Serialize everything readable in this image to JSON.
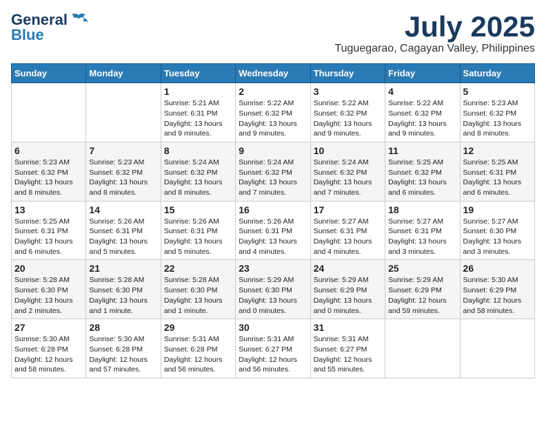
{
  "logo": {
    "line1": "General",
    "line2": "Blue"
  },
  "title": "July 2025",
  "location": "Tuguegarao, Cagayan Valley, Philippines",
  "days_of_week": [
    "Sunday",
    "Monday",
    "Tuesday",
    "Wednesday",
    "Thursday",
    "Friday",
    "Saturday"
  ],
  "weeks": [
    [
      {
        "day": "",
        "info": ""
      },
      {
        "day": "",
        "info": ""
      },
      {
        "day": "1",
        "info": "Sunrise: 5:21 AM\nSunset: 6:31 PM\nDaylight: 13 hours\nand 9 minutes."
      },
      {
        "day": "2",
        "info": "Sunrise: 5:22 AM\nSunset: 6:32 PM\nDaylight: 13 hours\nand 9 minutes."
      },
      {
        "day": "3",
        "info": "Sunrise: 5:22 AM\nSunset: 6:32 PM\nDaylight: 13 hours\nand 9 minutes."
      },
      {
        "day": "4",
        "info": "Sunrise: 5:22 AM\nSunset: 6:32 PM\nDaylight: 13 hours\nand 9 minutes."
      },
      {
        "day": "5",
        "info": "Sunrise: 5:23 AM\nSunset: 6:32 PM\nDaylight: 13 hours\nand 8 minutes."
      }
    ],
    [
      {
        "day": "6",
        "info": "Sunrise: 5:23 AM\nSunset: 6:32 PM\nDaylight: 13 hours\nand 8 minutes."
      },
      {
        "day": "7",
        "info": "Sunrise: 5:23 AM\nSunset: 6:32 PM\nDaylight: 13 hours\nand 8 minutes."
      },
      {
        "day": "8",
        "info": "Sunrise: 5:24 AM\nSunset: 6:32 PM\nDaylight: 13 hours\nand 8 minutes."
      },
      {
        "day": "9",
        "info": "Sunrise: 5:24 AM\nSunset: 6:32 PM\nDaylight: 13 hours\nand 7 minutes."
      },
      {
        "day": "10",
        "info": "Sunrise: 5:24 AM\nSunset: 6:32 PM\nDaylight: 13 hours\nand 7 minutes."
      },
      {
        "day": "11",
        "info": "Sunrise: 5:25 AM\nSunset: 6:32 PM\nDaylight: 13 hours\nand 6 minutes."
      },
      {
        "day": "12",
        "info": "Sunrise: 5:25 AM\nSunset: 6:31 PM\nDaylight: 13 hours\nand 6 minutes."
      }
    ],
    [
      {
        "day": "13",
        "info": "Sunrise: 5:25 AM\nSunset: 6:31 PM\nDaylight: 13 hours\nand 6 minutes."
      },
      {
        "day": "14",
        "info": "Sunrise: 5:26 AM\nSunset: 6:31 PM\nDaylight: 13 hours\nand 5 minutes."
      },
      {
        "day": "15",
        "info": "Sunrise: 5:26 AM\nSunset: 6:31 PM\nDaylight: 13 hours\nand 5 minutes."
      },
      {
        "day": "16",
        "info": "Sunrise: 5:26 AM\nSunset: 6:31 PM\nDaylight: 13 hours\nand 4 minutes."
      },
      {
        "day": "17",
        "info": "Sunrise: 5:27 AM\nSunset: 6:31 PM\nDaylight: 13 hours\nand 4 minutes."
      },
      {
        "day": "18",
        "info": "Sunrise: 5:27 AM\nSunset: 6:31 PM\nDaylight: 13 hours\nand 3 minutes."
      },
      {
        "day": "19",
        "info": "Sunrise: 5:27 AM\nSunset: 6:30 PM\nDaylight: 13 hours\nand 3 minutes."
      }
    ],
    [
      {
        "day": "20",
        "info": "Sunrise: 5:28 AM\nSunset: 6:30 PM\nDaylight: 13 hours\nand 2 minutes."
      },
      {
        "day": "21",
        "info": "Sunrise: 5:28 AM\nSunset: 6:30 PM\nDaylight: 13 hours\nand 1 minute."
      },
      {
        "day": "22",
        "info": "Sunrise: 5:28 AM\nSunset: 6:30 PM\nDaylight: 13 hours\nand 1 minute."
      },
      {
        "day": "23",
        "info": "Sunrise: 5:29 AM\nSunset: 6:30 PM\nDaylight: 13 hours\nand 0 minutes."
      },
      {
        "day": "24",
        "info": "Sunrise: 5:29 AM\nSunset: 6:29 PM\nDaylight: 13 hours\nand 0 minutes."
      },
      {
        "day": "25",
        "info": "Sunrise: 5:29 AM\nSunset: 6:29 PM\nDaylight: 12 hours\nand 59 minutes."
      },
      {
        "day": "26",
        "info": "Sunrise: 5:30 AM\nSunset: 6:29 PM\nDaylight: 12 hours\nand 58 minutes."
      }
    ],
    [
      {
        "day": "27",
        "info": "Sunrise: 5:30 AM\nSunset: 6:28 PM\nDaylight: 12 hours\nand 58 minutes."
      },
      {
        "day": "28",
        "info": "Sunrise: 5:30 AM\nSunset: 6:28 PM\nDaylight: 12 hours\nand 57 minutes."
      },
      {
        "day": "29",
        "info": "Sunrise: 5:31 AM\nSunset: 6:28 PM\nDaylight: 12 hours\nand 56 minutes."
      },
      {
        "day": "30",
        "info": "Sunrise: 5:31 AM\nSunset: 6:27 PM\nDaylight: 12 hours\nand 56 minutes."
      },
      {
        "day": "31",
        "info": "Sunrise: 5:31 AM\nSunset: 6:27 PM\nDaylight: 12 hours\nand 55 minutes."
      },
      {
        "day": "",
        "info": ""
      },
      {
        "day": "",
        "info": ""
      }
    ]
  ]
}
